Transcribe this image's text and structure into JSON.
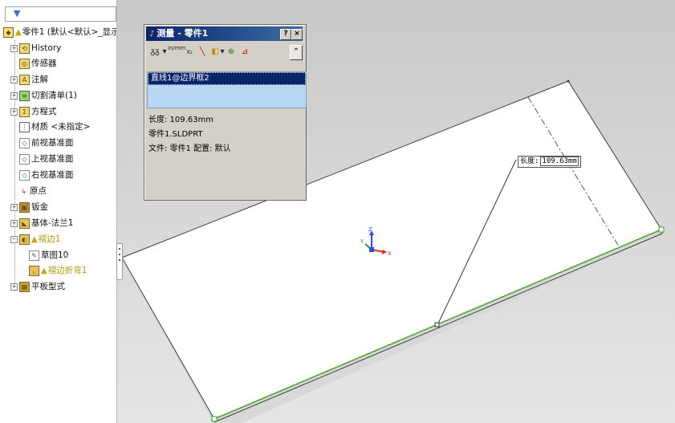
{
  "feature_tree": {
    "filter_icon": "funnel-icon",
    "items": [
      {
        "label": "零件1  (默认<默认>_显示状",
        "icon": "part-icon",
        "warning": true
      },
      {
        "label": "History",
        "icon": "history-icon"
      },
      {
        "label": "传感器",
        "icon": "sensor-icon"
      },
      {
        "label": "注解",
        "icon": "annotation-icon"
      },
      {
        "label": "切割清单(1)",
        "icon": "cutlist-icon"
      },
      {
        "label": "方程式",
        "icon": "equation-icon"
      },
      {
        "label": "材质 <未指定>",
        "icon": "material-icon"
      },
      {
        "label": "前视基准面",
        "icon": "plane-icon"
      },
      {
        "label": "上视基准面",
        "icon": "plane-icon"
      },
      {
        "label": "右视基准面",
        "icon": "plane-icon"
      },
      {
        "label": "原点",
        "icon": "origin-icon"
      },
      {
        "label": "钣金",
        "icon": "sheetmetal-icon"
      },
      {
        "label": "基体-法兰1",
        "icon": "baseflange-icon"
      },
      {
        "label": "褶边1",
        "icon": "hem-icon",
        "warning": true
      },
      {
        "label": "草图10",
        "icon": "sketch-icon"
      },
      {
        "label": "褶边折弯1",
        "icon": "bend-icon",
        "warning": true
      },
      {
        "label": "平板型式",
        "icon": "flatpattern-icon"
      }
    ]
  },
  "measure_dialog": {
    "title": "测量 - 零件1",
    "help_label": "?",
    "close_label": "×",
    "toolbar": {
      "arc_label": "ᵹ",
      "units_label": "in/mm",
      "xyz_label": "XYZ",
      "collapse_label": "⌃"
    },
    "selection": "直线1@边界框2",
    "results": {
      "length": "长度:  109.63mm",
      "part": "零件1.SLDPRT",
      "file": "文件:  零件1 配置:  默认"
    }
  },
  "graphics": {
    "dimension_label": "长度:",
    "dimension_value": "109.63mm",
    "triad_labels": {
      "x": "X",
      "y": "Y",
      "z": "Z"
    },
    "colors": {
      "background_top": "#c9c9c9",
      "background_bottom": "#e6e6e6",
      "plate_face": "#ffffff",
      "plate_edge": "#3c3c3c",
      "highlight_edge": "#5fbf3a",
      "triad_x": "#e0262a",
      "triad_y": "#2ca02c",
      "triad_z": "#2a52d6"
    }
  }
}
